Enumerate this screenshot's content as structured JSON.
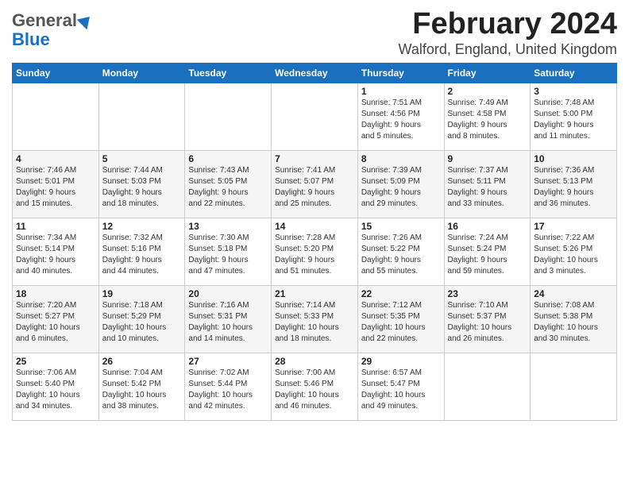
{
  "header": {
    "logo_general": "General",
    "logo_blue": "Blue",
    "month": "February 2024",
    "location": "Walford, England, United Kingdom"
  },
  "days_of_week": [
    "Sunday",
    "Monday",
    "Tuesday",
    "Wednesday",
    "Thursday",
    "Friday",
    "Saturday"
  ],
  "weeks": [
    [
      {
        "day": "",
        "info": ""
      },
      {
        "day": "",
        "info": ""
      },
      {
        "day": "",
        "info": ""
      },
      {
        "day": "",
        "info": ""
      },
      {
        "day": "1",
        "info": "Sunrise: 7:51 AM\nSunset: 4:56 PM\nDaylight: 9 hours\nand 5 minutes."
      },
      {
        "day": "2",
        "info": "Sunrise: 7:49 AM\nSunset: 4:58 PM\nDaylight: 9 hours\nand 8 minutes."
      },
      {
        "day": "3",
        "info": "Sunrise: 7:48 AM\nSunset: 5:00 PM\nDaylight: 9 hours\nand 11 minutes."
      }
    ],
    [
      {
        "day": "4",
        "info": "Sunrise: 7:46 AM\nSunset: 5:01 PM\nDaylight: 9 hours\nand 15 minutes."
      },
      {
        "day": "5",
        "info": "Sunrise: 7:44 AM\nSunset: 5:03 PM\nDaylight: 9 hours\nand 18 minutes."
      },
      {
        "day": "6",
        "info": "Sunrise: 7:43 AM\nSunset: 5:05 PM\nDaylight: 9 hours\nand 22 minutes."
      },
      {
        "day": "7",
        "info": "Sunrise: 7:41 AM\nSunset: 5:07 PM\nDaylight: 9 hours\nand 25 minutes."
      },
      {
        "day": "8",
        "info": "Sunrise: 7:39 AM\nSunset: 5:09 PM\nDaylight: 9 hours\nand 29 minutes."
      },
      {
        "day": "9",
        "info": "Sunrise: 7:37 AM\nSunset: 5:11 PM\nDaylight: 9 hours\nand 33 minutes."
      },
      {
        "day": "10",
        "info": "Sunrise: 7:36 AM\nSunset: 5:13 PM\nDaylight: 9 hours\nand 36 minutes."
      }
    ],
    [
      {
        "day": "11",
        "info": "Sunrise: 7:34 AM\nSunset: 5:14 PM\nDaylight: 9 hours\nand 40 minutes."
      },
      {
        "day": "12",
        "info": "Sunrise: 7:32 AM\nSunset: 5:16 PM\nDaylight: 9 hours\nand 44 minutes."
      },
      {
        "day": "13",
        "info": "Sunrise: 7:30 AM\nSunset: 5:18 PM\nDaylight: 9 hours\nand 47 minutes."
      },
      {
        "day": "14",
        "info": "Sunrise: 7:28 AM\nSunset: 5:20 PM\nDaylight: 9 hours\nand 51 minutes."
      },
      {
        "day": "15",
        "info": "Sunrise: 7:26 AM\nSunset: 5:22 PM\nDaylight: 9 hours\nand 55 minutes."
      },
      {
        "day": "16",
        "info": "Sunrise: 7:24 AM\nSunset: 5:24 PM\nDaylight: 9 hours\nand 59 minutes."
      },
      {
        "day": "17",
        "info": "Sunrise: 7:22 AM\nSunset: 5:26 PM\nDaylight: 10 hours\nand 3 minutes."
      }
    ],
    [
      {
        "day": "18",
        "info": "Sunrise: 7:20 AM\nSunset: 5:27 PM\nDaylight: 10 hours\nand 6 minutes."
      },
      {
        "day": "19",
        "info": "Sunrise: 7:18 AM\nSunset: 5:29 PM\nDaylight: 10 hours\nand 10 minutes."
      },
      {
        "day": "20",
        "info": "Sunrise: 7:16 AM\nSunset: 5:31 PM\nDaylight: 10 hours\nand 14 minutes."
      },
      {
        "day": "21",
        "info": "Sunrise: 7:14 AM\nSunset: 5:33 PM\nDaylight: 10 hours\nand 18 minutes."
      },
      {
        "day": "22",
        "info": "Sunrise: 7:12 AM\nSunset: 5:35 PM\nDaylight: 10 hours\nand 22 minutes."
      },
      {
        "day": "23",
        "info": "Sunrise: 7:10 AM\nSunset: 5:37 PM\nDaylight: 10 hours\nand 26 minutes."
      },
      {
        "day": "24",
        "info": "Sunrise: 7:08 AM\nSunset: 5:38 PM\nDaylight: 10 hours\nand 30 minutes."
      }
    ],
    [
      {
        "day": "25",
        "info": "Sunrise: 7:06 AM\nSunset: 5:40 PM\nDaylight: 10 hours\nand 34 minutes."
      },
      {
        "day": "26",
        "info": "Sunrise: 7:04 AM\nSunset: 5:42 PM\nDaylight: 10 hours\nand 38 minutes."
      },
      {
        "day": "27",
        "info": "Sunrise: 7:02 AM\nSunset: 5:44 PM\nDaylight: 10 hours\nand 42 minutes."
      },
      {
        "day": "28",
        "info": "Sunrise: 7:00 AM\nSunset: 5:46 PM\nDaylight: 10 hours\nand 46 minutes."
      },
      {
        "day": "29",
        "info": "Sunrise: 6:57 AM\nSunset: 5:47 PM\nDaylight: 10 hours\nand 49 minutes."
      },
      {
        "day": "",
        "info": ""
      },
      {
        "day": "",
        "info": ""
      }
    ]
  ]
}
